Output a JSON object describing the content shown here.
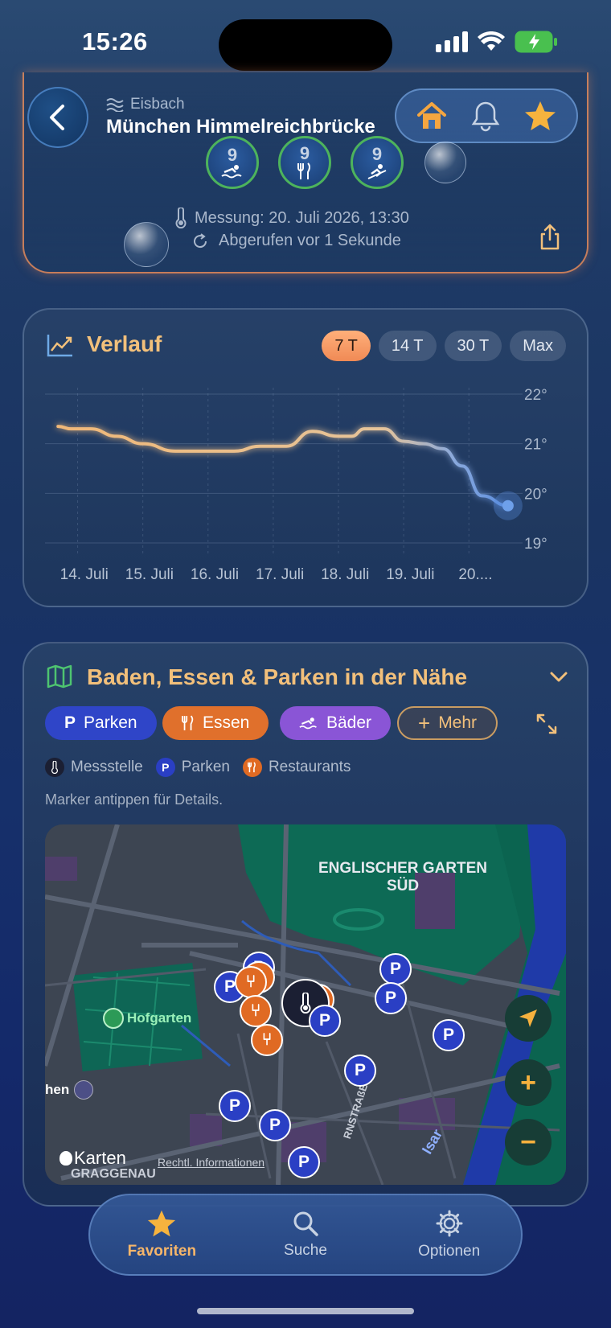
{
  "status": {
    "time": "15:26"
  },
  "header": {
    "river": "Eisbach",
    "station": "München Himmelreichbrücke"
  },
  "scores": [
    {
      "value": "9",
      "icon": "swimmer-icon"
    },
    {
      "value": "9",
      "icon": "cutlery-icon"
    },
    {
      "value": "9",
      "icon": "surfer-icon"
    }
  ],
  "measurement": {
    "measured": "Messung: 20. Juli 2026, 13:30",
    "fetched": "Abgerufen vor 1 Sekunde"
  },
  "history": {
    "title": "Verlauf",
    "ranges": [
      "7 T",
      "14 T",
      "30 T",
      "Max"
    ],
    "active_range": "7 T"
  },
  "chart_data": {
    "type": "line",
    "title": "Verlauf",
    "x_labels": [
      "14. Juli",
      "15. Juli",
      "16. Juli",
      "17. Juli",
      "18. Juli",
      "19. Juli",
      "20...."
    ],
    "y_ticks": [
      "22°",
      "21°",
      "20°",
      "19°"
    ],
    "ylim": [
      19,
      22
    ],
    "series": [
      {
        "values_x": [
          13.5,
          13.7,
          14.0,
          14.4,
          14.8,
          15.3,
          15.8,
          16.2,
          16.6,
          17.0,
          17.4,
          17.8,
          18.0,
          18.2,
          18.5,
          18.8,
          19.1,
          19.4,
          19.7,
          20.0,
          20.4
        ],
        "values_y": [
          21.35,
          21.3,
          21.3,
          21.15,
          21.0,
          20.85,
          20.85,
          20.85,
          20.95,
          20.95,
          21.25,
          21.15,
          21.15,
          21.3,
          21.3,
          21.05,
          21.0,
          20.9,
          20.55,
          19.95,
          19.75
        ]
      }
    ],
    "grid": true
  },
  "nearby": {
    "title": "Baden, Essen & Parken in der Nähe",
    "chips": [
      {
        "label": "Parken",
        "icon": "parking-icon",
        "color": "#2f45c8"
      },
      {
        "label": "Essen",
        "icon": "cutlery-icon",
        "color": "#e0702c"
      },
      {
        "label": "Bäder",
        "icon": "swim-icon",
        "color": "#8a55d6"
      },
      {
        "label": "Mehr",
        "icon": "plus-icon",
        "color": "#3c4556"
      }
    ],
    "legend": [
      "Messstelle",
      "Parken",
      "Restaurants"
    ],
    "hint": "Marker antippen für Details.",
    "map": {
      "area_label": "ENGLISCHER GARTEN SÜD",
      "park_label": "Hofgarten",
      "cut_label": "hen",
      "river_label": "Isar",
      "street_label": "RNSTRAßE",
      "district_label": "GRAGGENAU",
      "provider": "Karten",
      "legal": "Rechtl. Informationen"
    }
  },
  "tabbar": [
    {
      "label": "Favoriten",
      "active": true
    },
    {
      "label": "Suche",
      "active": false
    },
    {
      "label": "Optionen",
      "active": false
    }
  ]
}
